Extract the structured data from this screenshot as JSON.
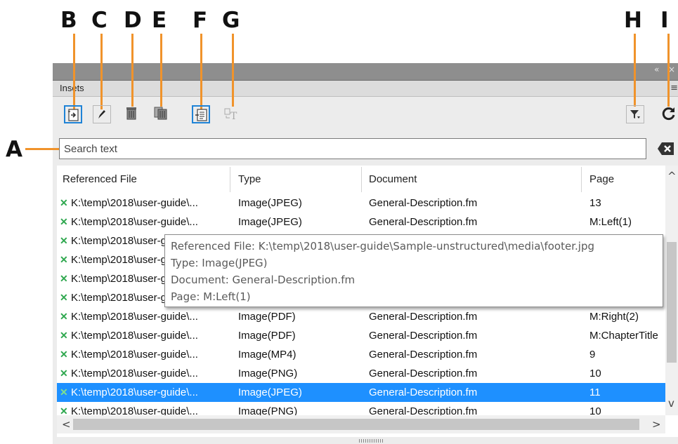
{
  "callouts": [
    "A",
    "B",
    "C",
    "D",
    "E",
    "F",
    "G",
    "H",
    "I"
  ],
  "panel": {
    "title_controls": {
      "collapse": "«",
      "close": "×"
    },
    "tab_label": "Insets",
    "menu_icon": "≡"
  },
  "toolbar": {
    "buttons": [
      {
        "name": "insert-inset",
        "icon": "insert-icon"
      },
      {
        "name": "edit-inset",
        "icon": "pencil-icon"
      },
      {
        "name": "delete-inset",
        "icon": "trash-icon"
      },
      {
        "name": "delete-all",
        "icon": "trash-multiple-icon"
      },
      {
        "name": "go-to-inset",
        "icon": "goto-icon"
      },
      {
        "name": "convert-to-text",
        "icon": "convert-text-icon"
      },
      {
        "name": "filter",
        "icon": "filter-icon"
      },
      {
        "name": "refresh",
        "icon": "refresh-icon"
      }
    ]
  },
  "search": {
    "placeholder": "Search text",
    "value": ""
  },
  "table": {
    "columns": [
      "Referenced File",
      "Type",
      "Document",
      "Page"
    ],
    "rows": [
      {
        "file": "K:\\temp\\2018\\user-guide\\...",
        "type": "Image(JPEG)",
        "document": "General-Description.fm",
        "page": "13"
      },
      {
        "file": "K:\\temp\\2018\\user-guide\\...",
        "type": "Image(JPEG)",
        "document": "General-Description.fm",
        "page": "M:Left(1)"
      },
      {
        "file": "K:\\temp\\2018\\user-guide\\...",
        "type": "",
        "document": "",
        "page": ""
      },
      {
        "file": "K:\\temp\\2018\\user-guide\\...",
        "type": "",
        "document": "",
        "page": ""
      },
      {
        "file": "K:\\temp\\2018\\user-guide\\...",
        "type": "",
        "document": "",
        "page": ""
      },
      {
        "file": "K:\\temp\\2018\\user-guide\\...",
        "type": "",
        "document": "",
        "page": ""
      },
      {
        "file": "K:\\temp\\2018\\user-guide\\...",
        "type": "Image(PDF)",
        "document": "General-Description.fm",
        "page": "M:Right(2)"
      },
      {
        "file": "K:\\temp\\2018\\user-guide\\...",
        "type": "Image(PDF)",
        "document": "General-Description.fm",
        "page": "M:ChapterTitle"
      },
      {
        "file": "K:\\temp\\2018\\user-guide\\...",
        "type": "Image(MP4)",
        "document": "General-Description.fm",
        "page": "9"
      },
      {
        "file": "K:\\temp\\2018\\user-guide\\...",
        "type": "Image(PNG)",
        "document": "General-Description.fm",
        "page": "10"
      },
      {
        "file": "K:\\temp\\2018\\user-guide\\...",
        "type": "Image(JPEG)",
        "document": "General-Description.fm",
        "page": "11",
        "selected": true
      },
      {
        "file": "K:\\temp\\2018\\user-guide\\...",
        "type": "Image(PNG)",
        "document": "General-Description.fm",
        "page": "10"
      }
    ],
    "status_mark": "✕"
  },
  "tooltip": {
    "file": "Referenced File: K:\\temp\\2018\\user-guide\\Sample-unstructured\\media\\footer.jpg",
    "type": "Type: Image(JPEG)",
    "document": "Document: General-Description.fm",
    "page": "Page: M:Left(1)"
  },
  "scroll": {
    "up": "^",
    "down": "v",
    "left": "<",
    "right": ">"
  },
  "colors": {
    "accent": "#1f83d6",
    "selection": "#1e90ff",
    "callout_line": "#f0932b",
    "status_mark": "#2fa84f"
  }
}
